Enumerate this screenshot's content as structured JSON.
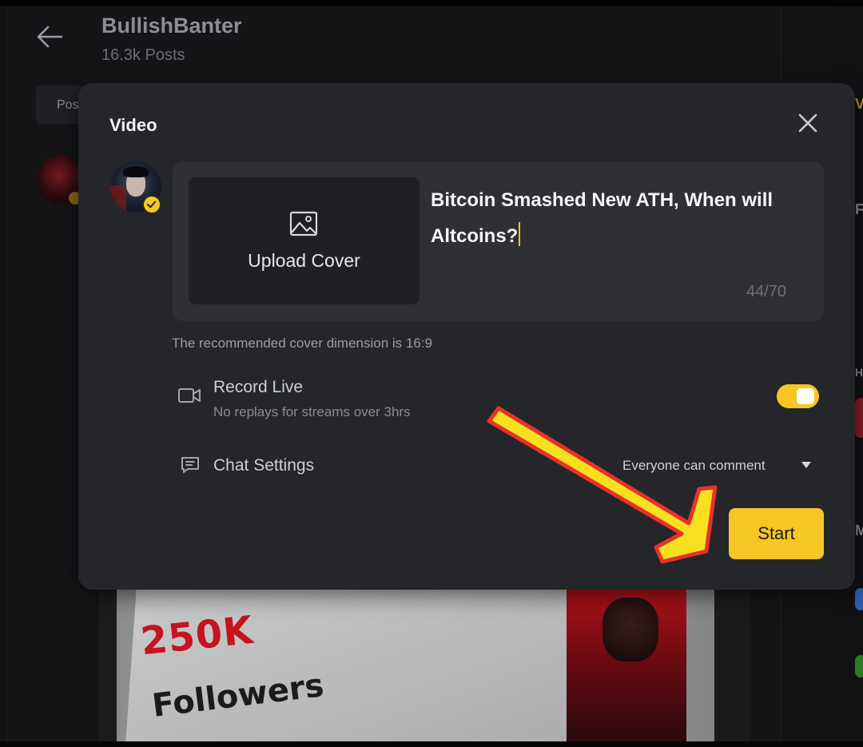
{
  "background": {
    "profile_name": "BullishBanter",
    "profile_posts": "16.3k Posts",
    "tab_label": "Pos",
    "image_text_big": "250K",
    "image_text_small": "Followers",
    "right_letters": [
      "V",
      "F",
      "H",
      "M"
    ]
  },
  "modal": {
    "title": "Video",
    "upload_cover_label": "Upload Cover",
    "post_title": "Bitcoin Smashed New ATH, When will Altcoins?",
    "char_count": "44/70",
    "recommendation": "The recommended cover dimension is 16:9",
    "record_live": {
      "title": "Record Live",
      "subtitle": "No replays for streams over 3hrs",
      "enabled": true
    },
    "chat_settings": {
      "title": "Chat Settings",
      "selected": "Everyone can comment"
    },
    "start_label": "Start"
  },
  "colors": {
    "accent": "#f6c624",
    "modal_bg": "#24262a",
    "annotation_arrow_fill": "#f7e020",
    "annotation_arrow_outline": "#e8312a"
  },
  "icons": {
    "back": "arrow-left-icon",
    "close": "close-icon",
    "upload": "image-icon",
    "record": "video-camera-icon",
    "chat": "chat-bubble-icon",
    "dropdown": "caret-down-icon",
    "verified": "verified-check-icon"
  }
}
